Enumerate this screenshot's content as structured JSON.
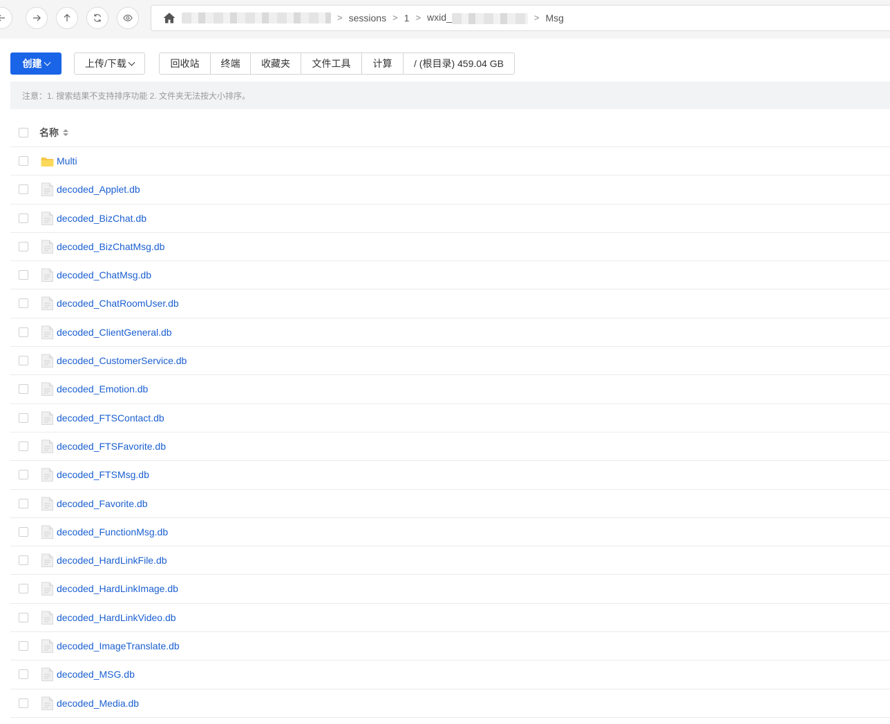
{
  "nav": {
    "back_icon": "arrow-left-icon",
    "forward_icon": "arrow-right-icon",
    "up_icon": "arrow-up-icon",
    "refresh_icon": "refresh-icon",
    "view_icon": "eye-icon"
  },
  "breadcrumb": {
    "home_icon": "home-icon",
    "items": [
      "sessions",
      "1",
      "wxid_",
      "Msg"
    ],
    "separator": ">"
  },
  "toolbar": {
    "create_label": "创建",
    "upload_label": "上传/下载",
    "group": [
      "回收站",
      "终端",
      "收藏夹",
      "文件工具",
      "计算",
      "/ (根目录) 459.04 GB"
    ]
  },
  "notice": "注意：1. 搜索结果不支持排序功能 2. 文件夹无法按大小排序。",
  "table": {
    "name_header": "名称",
    "files": [
      {
        "name": "Multi",
        "type": "folder"
      },
      {
        "name": "decoded_Applet.db",
        "type": "file"
      },
      {
        "name": "decoded_BizChat.db",
        "type": "file"
      },
      {
        "name": "decoded_BizChatMsg.db",
        "type": "file"
      },
      {
        "name": "decoded_ChatMsg.db",
        "type": "file"
      },
      {
        "name": "decoded_ChatRoomUser.db",
        "type": "file"
      },
      {
        "name": "decoded_ClientGeneral.db",
        "type": "file"
      },
      {
        "name": "decoded_CustomerService.db",
        "type": "file"
      },
      {
        "name": "decoded_Emotion.db",
        "type": "file"
      },
      {
        "name": "decoded_FTSContact.db",
        "type": "file"
      },
      {
        "name": "decoded_FTSFavorite.db",
        "type": "file"
      },
      {
        "name": "decoded_FTSMsg.db",
        "type": "file"
      },
      {
        "name": "decoded_Favorite.db",
        "type": "file"
      },
      {
        "name": "decoded_FunctionMsg.db",
        "type": "file"
      },
      {
        "name": "decoded_HardLinkFile.db",
        "type": "file"
      },
      {
        "name": "decoded_HardLinkImage.db",
        "type": "file"
      },
      {
        "name": "decoded_HardLinkVideo.db",
        "type": "file"
      },
      {
        "name": "decoded_ImageTranslate.db",
        "type": "file"
      },
      {
        "name": "decoded_MSG.db",
        "type": "file"
      },
      {
        "name": "decoded_Media.db",
        "type": "file"
      }
    ]
  },
  "colors": {
    "primary": "#1a64e8",
    "link": "#1a5fd0",
    "folder": "#f7c948"
  }
}
